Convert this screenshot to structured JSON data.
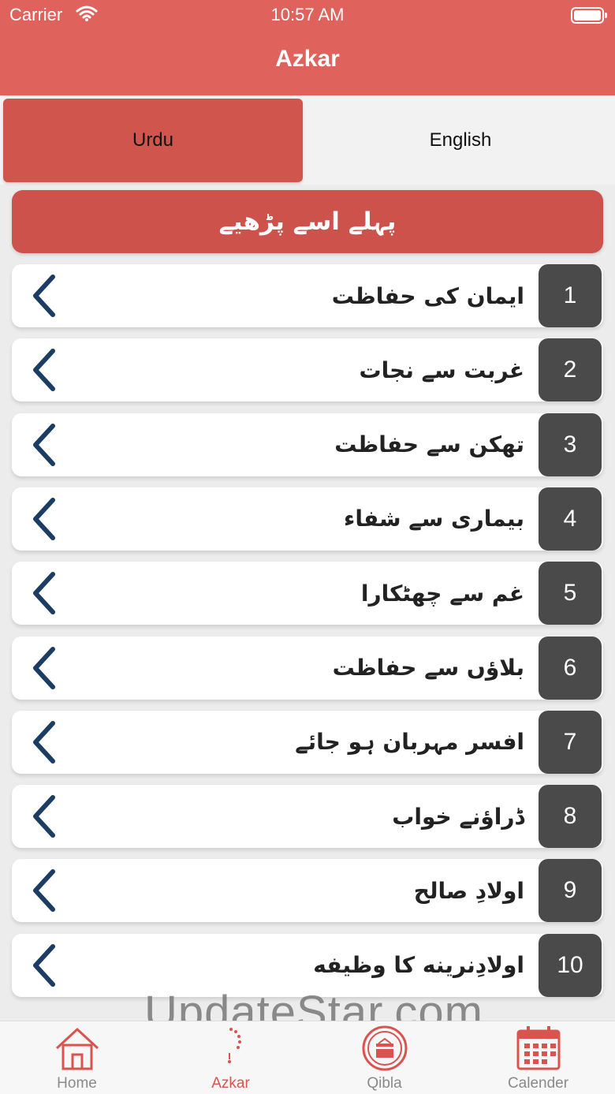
{
  "status": {
    "carrier": "Carrier",
    "time": "10:57 AM"
  },
  "nav": {
    "title": "Azkar"
  },
  "segments": {
    "urdu": "Urdu",
    "english": "English",
    "selected": "Urdu"
  },
  "read_first": "پہلے اسے پڑھیے",
  "items": [
    {
      "num": "1",
      "title": "ایمان کی حفاظت"
    },
    {
      "num": "2",
      "title": "غربت سے نجات"
    },
    {
      "num": "3",
      "title": "تھکن سے حفاظت"
    },
    {
      "num": "4",
      "title": "بیماری سے شفاء"
    },
    {
      "num": "5",
      "title": "غم سے چھٹکارا"
    },
    {
      "num": "6",
      "title": "بلاؤں سے حفاظت"
    },
    {
      "num": "7",
      "title": "افسر مہربان ہو جائے"
    },
    {
      "num": "8",
      "title": "ڈراؤنے خواب"
    },
    {
      "num": "9",
      "title": "اولادِ صالح"
    },
    {
      "num": "10",
      "title": "اولادِنرینه کا وظیفه"
    }
  ],
  "watermark": "UpdateStar.com",
  "tabs": [
    {
      "label": "Home",
      "icon": "home-icon"
    },
    {
      "label": "Azkar",
      "icon": "tasbih-icon"
    },
    {
      "label": "Qibla",
      "icon": "kaaba-icon"
    },
    {
      "label": "Calender",
      "icon": "calendar-icon"
    }
  ],
  "colors": {
    "header": "#e0625c",
    "accent": "#cd524b",
    "badge": "#4a4a4a",
    "chevron": "#1c3d63"
  }
}
